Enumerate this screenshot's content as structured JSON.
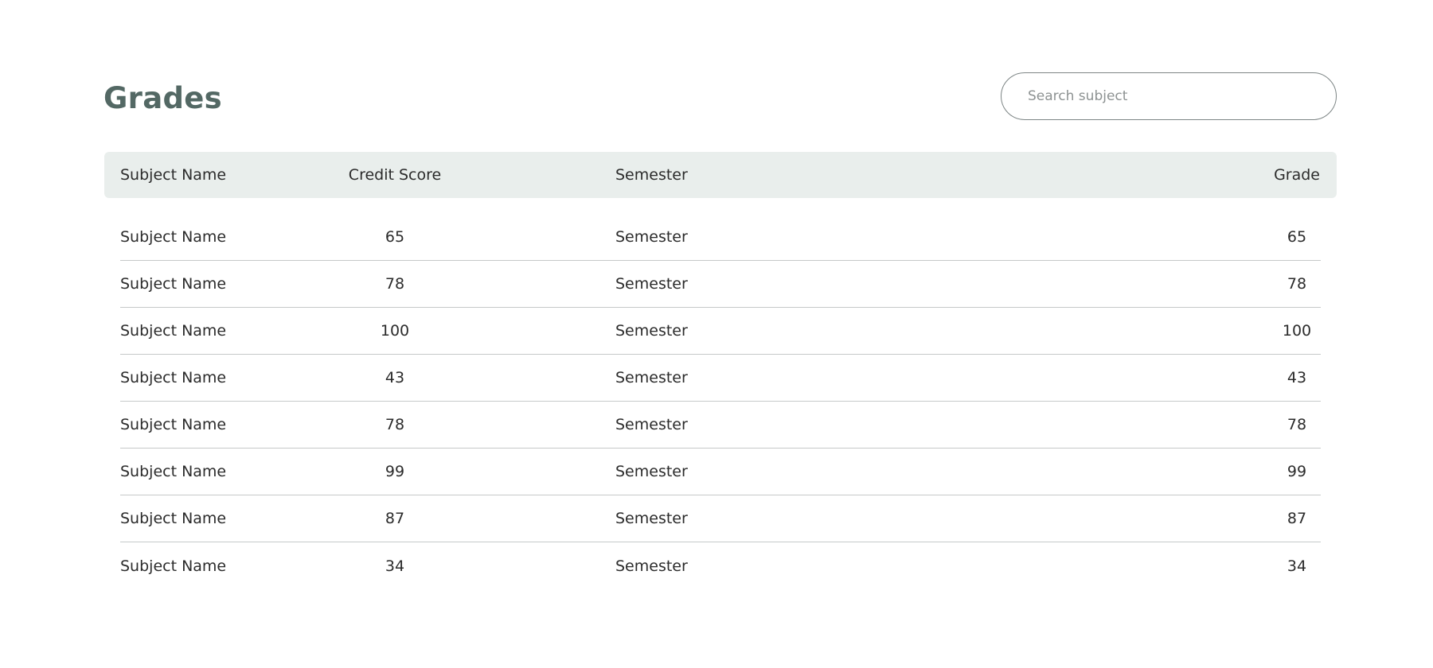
{
  "page": {
    "title": "Grades"
  },
  "search": {
    "placeholder": "Search subject",
    "value": ""
  },
  "table": {
    "columns": {
      "subject": "Subject Name",
      "credit": "Credit Score",
      "semester": "Semester",
      "grade": "Grade"
    },
    "rows": [
      {
        "subject": "Subject Name",
        "credit": "65",
        "semester": "Semester",
        "grade": "65"
      },
      {
        "subject": "Subject Name",
        "credit": "78",
        "semester": "Semester",
        "grade": "78"
      },
      {
        "subject": "Subject Name",
        "credit": "100",
        "semester": "Semester",
        "grade": "100"
      },
      {
        "subject": "Subject Name",
        "credit": "43",
        "semester": "Semester",
        "grade": "43"
      },
      {
        "subject": "Subject Name",
        "credit": "78",
        "semester": "Semester",
        "grade": "78"
      },
      {
        "subject": "Subject Name",
        "credit": "99",
        "semester": "Semester",
        "grade": "99"
      },
      {
        "subject": "Subject Name",
        "credit": "87",
        "semester": "Semester",
        "grade": "87"
      },
      {
        "subject": "Subject Name",
        "credit": "34",
        "semester": "Semester",
        "grade": "34"
      }
    ]
  },
  "colors": {
    "title": "#536864",
    "header_background": "#e9eeec",
    "row_divider": "#c6c9c9",
    "search_border": "#7d8585"
  }
}
